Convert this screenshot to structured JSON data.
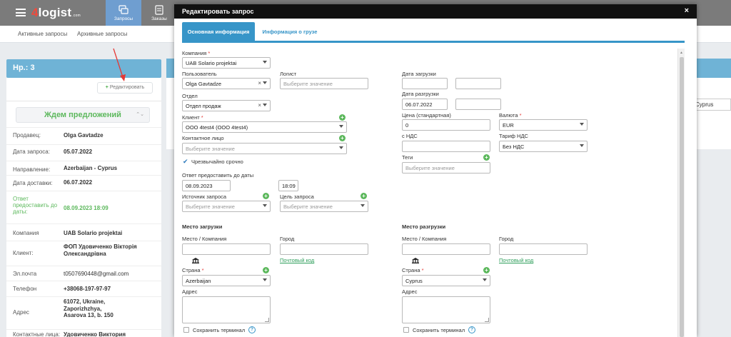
{
  "app": {
    "logo": "4logist",
    "logo_suffix": ".com",
    "nav": [
      {
        "label": "Запросы",
        "icon": "requests-icon"
      },
      {
        "label": "Заказы",
        "icon": "orders-icon"
      }
    ],
    "subnav": [
      "Активные запросы",
      "Архивные запросы"
    ]
  },
  "left_panel": {
    "title": "Нр.: 3",
    "edit_label": "Редактировать",
    "status": "Ждем предложений",
    "rows": [
      {
        "k": "Продавец:",
        "v": "Olga Gavtadze"
      },
      {
        "k": "Дата запроса:",
        "v": "05.07.2022"
      },
      {
        "k": "Направление:",
        "v": "Azerbaijan - Cyprus"
      },
      {
        "k": "Дата доставки:",
        "v": "06.07.2022"
      },
      {
        "k": "Ответ предоставить до даты:",
        "v": "08.09.2023 18:09"
      },
      {
        "k": "Компания",
        "v": "UAB Solario projektai"
      },
      {
        "k": "Клиент:",
        "v": "ФОП Удовиченко Вікторія Олександрівна"
      },
      {
        "k": "Эл.почта",
        "v": "t0507690448@gmail.com"
      },
      {
        "k": "Телефон",
        "v": "+38068-197-97-97"
      },
      {
        "k": "Адрес",
        "v": "61072, Ukraine, Zaporizhzhya, Asarova 13, b. 150"
      },
      {
        "k": "Контактные лица:",
        "v": "Удовиченко Виктория"
      }
    ]
  },
  "right_bg": {
    "country_value": "Cyprus"
  },
  "modal": {
    "title": "Редактировать запрос",
    "close": "×",
    "tabs": [
      "Основная информация",
      "Информация о грузе"
    ],
    "company": {
      "label": "Компания",
      "value": "UAB Solario projektai"
    },
    "user": {
      "label": "Пользователь",
      "value": "Olga Gavtadze"
    },
    "logist": {
      "label": "Логист",
      "placeholder": "Выберите значение"
    },
    "department": {
      "label": "Отдел",
      "value": "Отдел продаж"
    },
    "client": {
      "label": "Клиент",
      "value": "ООО 4test4 (ООО 4test4)"
    },
    "contact": {
      "label": "Контактное лицо",
      "placeholder": "Выберите значение"
    },
    "urgent": {
      "label": "Чрезвычайно срочно",
      "checked": true
    },
    "answer_by": {
      "label": "Ответ предоставить до даты",
      "date": "08.09.2023",
      "time": "18:09"
    },
    "source": {
      "label": "Источник запроса",
      "placeholder": "Выберите значение"
    },
    "purpose": {
      "label": "Цель запроса",
      "placeholder": "Выберите значение"
    },
    "load_date": {
      "label": "Дата загрузки",
      "value": "",
      "value2": ""
    },
    "unload_date": {
      "label": "Дата разгрузки",
      "value": "06.07.2022",
      "value2": ""
    },
    "price": {
      "label": "Цена (стандартная)",
      "value": "0"
    },
    "currency": {
      "label": "Валюта",
      "value": "EUR"
    },
    "vat_price": {
      "label": "с НДС",
      "value": ""
    },
    "vat_rate": {
      "label": "Тариф НДС",
      "value": "Без НДС"
    },
    "tags": {
      "label": "Теги",
      "placeholder": "Выберите значение"
    },
    "loading": {
      "title": "Место загрузки",
      "place_label": "Место / Компания",
      "city_label": "Город",
      "postal_link": "Почтовый код",
      "country_label": "Страна",
      "country": "Azerbaijan",
      "address_label": "Адрес",
      "save_terminal": "Сохранить терминал"
    },
    "unloading": {
      "title": "Место разгрузки",
      "place_label": "Место / Компания",
      "city_label": "Город",
      "postal_link": "Почтовый код",
      "country_label": "Страна",
      "country": "Cyprus",
      "address_label": "Адрес",
      "save_terminal": "Сохранить терминал"
    },
    "help_glyph": "?",
    "req_mark": "*"
  },
  "colors": {
    "accent": "#3795c8",
    "add_green": "#5cb85c",
    "header": "#111111",
    "topbar": "#7b7b7b",
    "arrow": "#e53935"
  }
}
